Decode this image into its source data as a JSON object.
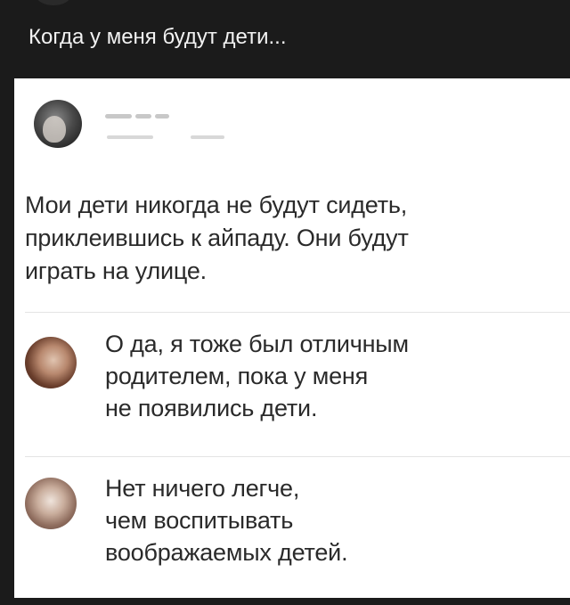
{
  "header": {
    "title": "Когда у меня будут дети..."
  },
  "post": {
    "text_lines": [
      "Мои дети никогда не будут сидеть,",
      "приклеившись к айпаду. Они будут",
      "играть на улице."
    ]
  },
  "comments": [
    {
      "lines": [
        "О да, я тоже был отличным",
        "родителем, пока у меня",
        "не появились дети."
      ]
    },
    {
      "lines": [
        "Нет ничего легче,",
        "чем воспитывать",
        "воображаемых детей."
      ]
    }
  ]
}
